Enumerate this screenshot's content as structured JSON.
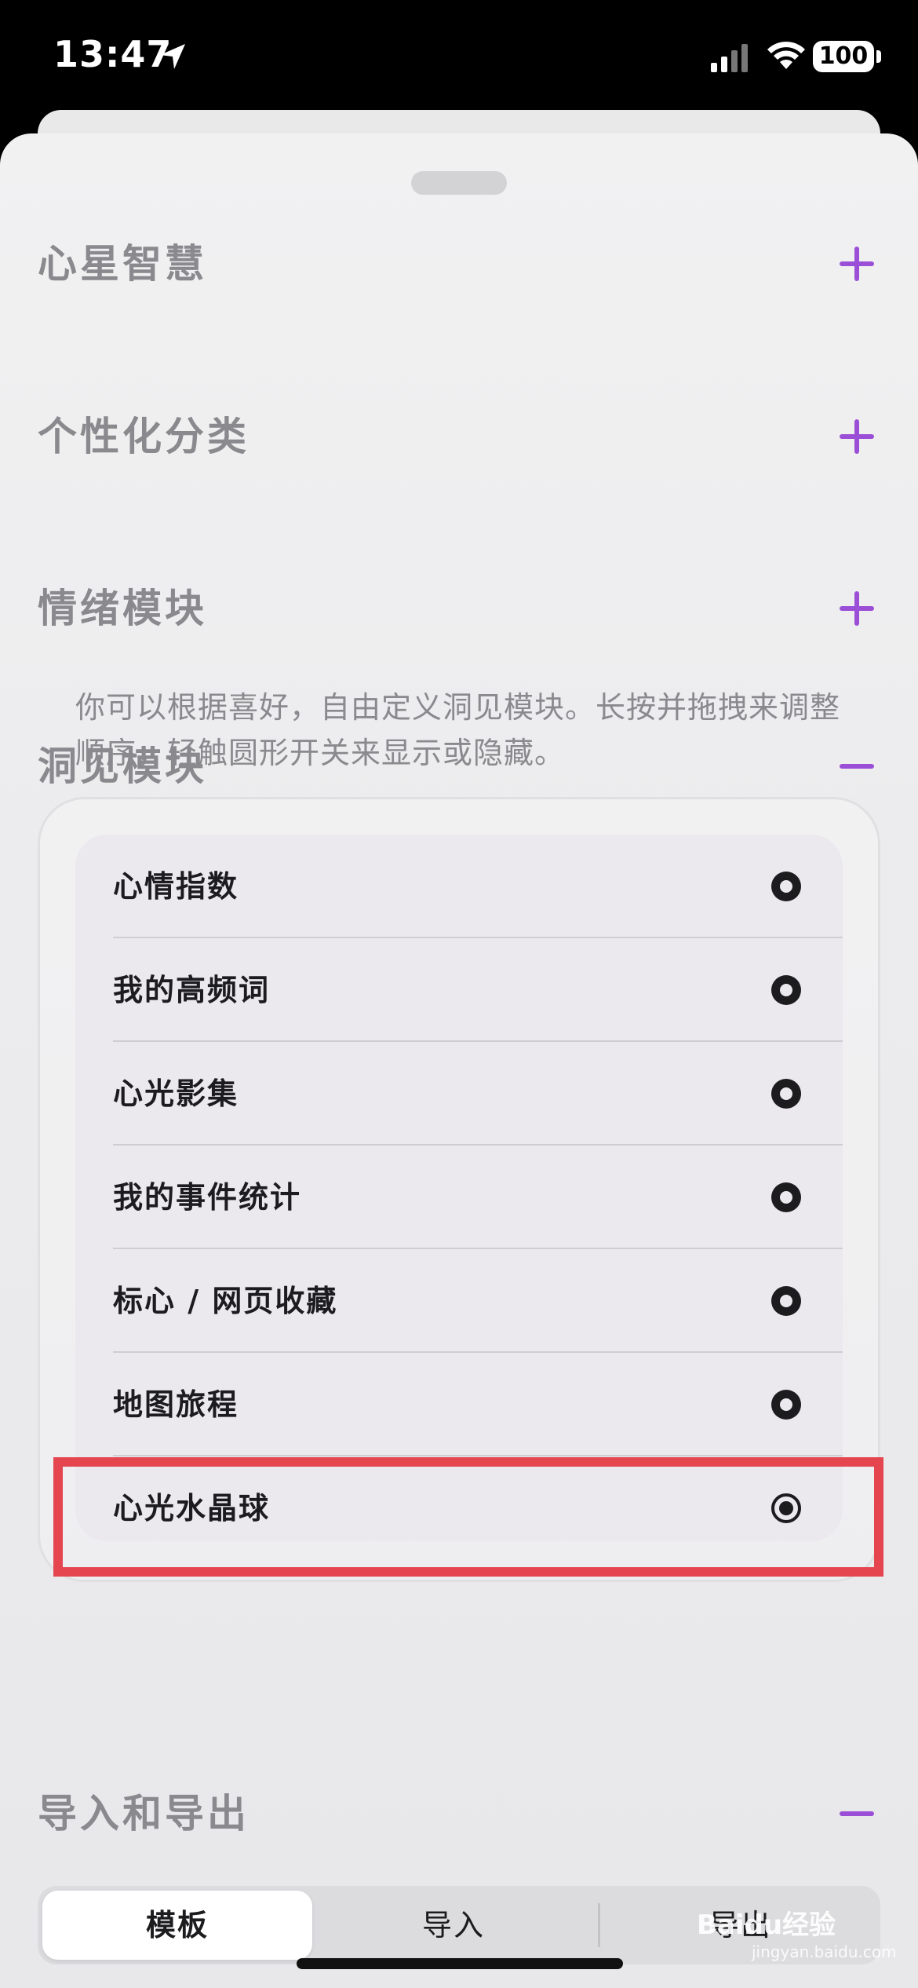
{
  "status_bar": {
    "time": "13:47",
    "battery": "100",
    "icons": [
      "location-arrow-icon",
      "signal-icon",
      "wifi-icon",
      "battery-icon"
    ]
  },
  "sections": [
    {
      "title": "心星智慧",
      "toggle": "plus-icon"
    },
    {
      "title": "个性化分类",
      "toggle": "plus-icon"
    },
    {
      "title": "情绪模块",
      "toggle": "plus-icon"
    },
    {
      "title": "洞见模块",
      "toggle": "minus-icon"
    }
  ],
  "insight": {
    "description": "你可以根据喜好，自由定义洞见模块。长按并拖拽来调整顺序，轻触圆形开关来显示或隐藏。",
    "items": [
      {
        "label": "心情指数",
        "enabled": true
      },
      {
        "label": "我的高频词",
        "enabled": true
      },
      {
        "label": "心光影集",
        "enabled": true
      },
      {
        "label": "我的事件统计",
        "enabled": true
      },
      {
        "label": "标心 / 网页收藏",
        "enabled": true
      },
      {
        "label": "地图旅程",
        "enabled": true
      },
      {
        "label": "心光水晶球",
        "enabled": false
      }
    ]
  },
  "import_export": {
    "title": "导入和导出",
    "toggle": "minus-icon",
    "tabs": [
      {
        "label": "模板",
        "active": true
      },
      {
        "label": "导入",
        "active": false
      },
      {
        "label": "导出",
        "active": false
      }
    ]
  },
  "watermark": {
    "text": "Baidu经验",
    "sub": "jingyan.baidu.com"
  },
  "colors": {
    "accent": "#9b4fd6",
    "highlight": "#e4454f",
    "section_title": "#8a8a8e"
  }
}
